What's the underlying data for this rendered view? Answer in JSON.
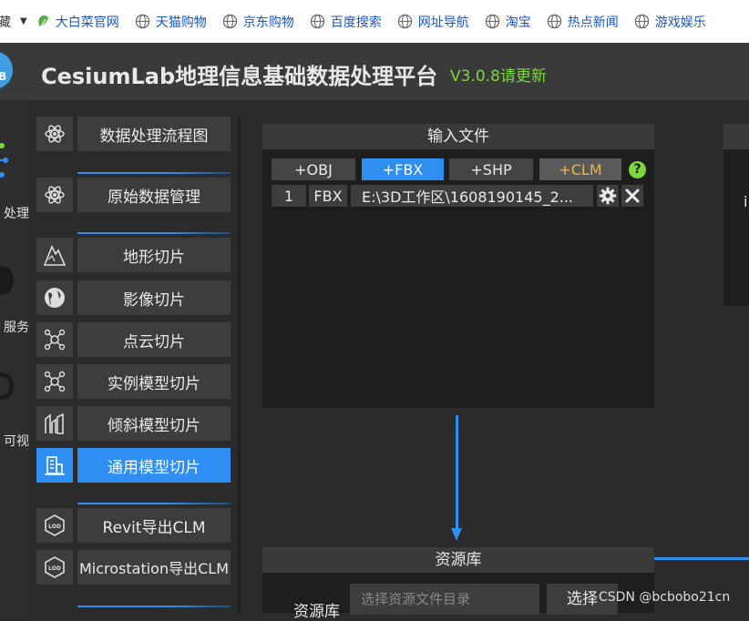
{
  "bookmarks": {
    "cut_left_text": "藏",
    "items": [
      {
        "label": "大白菜官网",
        "icon": "leaf-icon"
      },
      {
        "label": "天猫购物",
        "icon": "globe-icon"
      },
      {
        "label": "京东购物",
        "icon": "globe-icon"
      },
      {
        "label": "百度搜索",
        "icon": "globe-icon"
      },
      {
        "label": "网址导航",
        "icon": "globe-icon"
      },
      {
        "label": "淘宝",
        "icon": "globe-icon"
      },
      {
        "label": "热点新闻",
        "icon": "globe-icon"
      },
      {
        "label": "游戏娱乐",
        "icon": "globe-icon"
      }
    ]
  },
  "header": {
    "logo_text": "B",
    "title": "CesiumLab地理信息基础数据处理平台",
    "version": "V3.0.8请更新"
  },
  "left_strip": {
    "items": [
      "处理",
      "服务",
      "可视"
    ]
  },
  "menu": {
    "items": [
      {
        "label": "数据处理流程图",
        "icon": "atom-icon",
        "active": false
      },
      {
        "label": "原始数据管理",
        "icon": "atom-icon",
        "active": false
      },
      {
        "label": "地形切片",
        "icon": "mountain-icon",
        "active": false
      },
      {
        "label": "影像切片",
        "icon": "globe-icon",
        "active": false
      },
      {
        "label": "点云切片",
        "icon": "point-cloud-icon",
        "active": false
      },
      {
        "label": "实例模型切片",
        "icon": "point-cloud-icon",
        "active": false
      },
      {
        "label": "倾斜模型切片",
        "icon": "building-icon",
        "active": false
      },
      {
        "label": "通用模型切片",
        "icon": "model-icon",
        "active": true
      },
      {
        "label": "Revit导出CLM",
        "icon": "lod-icon",
        "active": false
      },
      {
        "label": "Microstation导出CLM",
        "icon": "lod-icon",
        "active": false
      }
    ]
  },
  "input_panel": {
    "title": "输入文件",
    "buttons": [
      "+OBJ",
      "+FBX",
      "+SHP",
      "+CLM"
    ],
    "help": "?",
    "files": [
      {
        "index": "1",
        "type": "FBX",
        "path": "E:\\3D工作区\\1608190145_2..."
      }
    ]
  },
  "right_panel": {
    "partial_text": "i"
  },
  "resource_panel": {
    "title": "资源库",
    "label": "资源库",
    "placeholder": "选择资源文件目录",
    "select_button": "选择"
  },
  "watermark": "CSDN @bcbobo21cn",
  "colors": {
    "accent_blue": "#2e8ef2",
    "version_green": "#7dd63c",
    "clm_orange": "#e8b45a"
  }
}
